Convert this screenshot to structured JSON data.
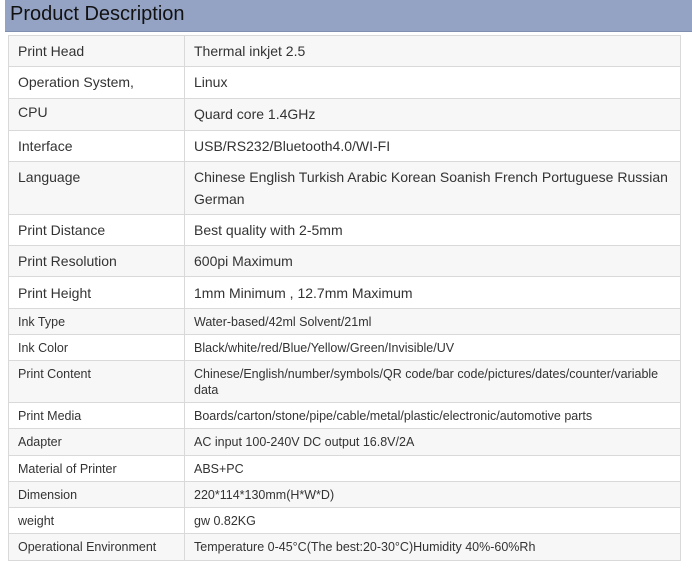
{
  "title": "Product Description",
  "rows": [
    {
      "label": "Print Head",
      "value": "Thermal inkjet 2.5"
    },
    {
      "label": "Operation System,",
      "value": "Linux"
    },
    {
      "label": "CPU",
      "value": "Quard core 1.4GHz"
    },
    {
      "label": "Interface",
      "value": "USB/RS232/Bluetooth4.0/WI-FI"
    },
    {
      "label": "Language",
      "value": "Chinese English Turkish Arabic Korean Soanish French Portuguese Russian German"
    },
    {
      "label": "Print Distance",
      "value": "Best quality with 2-5mm"
    },
    {
      "label": "Print Resolution",
      "value": "600pi Maximum"
    },
    {
      "label": "Print Height",
      "value": "1mm Minimum , 12.7mm Maximum"
    },
    {
      "label": "Ink Type",
      "value": "Water-based/42ml Solvent/21ml"
    },
    {
      "label": "Ink Color",
      "value": "Black/white/red/Blue/Yellow/Green/Invisible/UV"
    },
    {
      "label": "Print Content",
      "value": "Chinese/English/number/symbols/QR code/bar code/pictures/dates/counter/variable data"
    },
    {
      "label": "Print Media",
      "value": "Boards/carton/stone/pipe/cable/metal/plastic/electronic/automotive parts"
    },
    {
      "label": "Adapter",
      "value": "AC input 100-240V DC output 16.8V/2A"
    },
    {
      "label": "Material of Printer",
      "value": "ABS+PC"
    },
    {
      "label": "Dimension",
      "value": "220*114*130mm(H*W*D)"
    },
    {
      "label": "weight",
      "value": "gw 0.82KG"
    },
    {
      "label": "Operational Environment",
      "value": "Temperature 0-45°C(The best:20-30°C)Humidity 40%-60%Rh"
    }
  ]
}
